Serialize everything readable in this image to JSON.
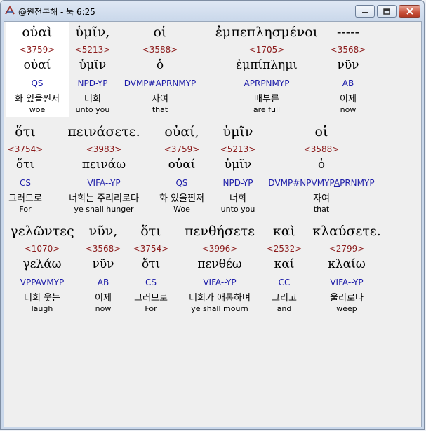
{
  "window": {
    "title": "@원전본해 - 눅 6:25",
    "buttons": {
      "minimize": "minimize-icon",
      "maximize": "maximize-icon",
      "close": "close-icon"
    }
  },
  "rows": [
    {
      "words": [
        {
          "greek": "οὐαὶ",
          "strong": "<3759>",
          "lemma": "οὐαί",
          "morph": "QS",
          "korean": "화 있을찐저",
          "english": "woe"
        },
        {
          "greek": "ὑμῖν,",
          "strong": "<5213>",
          "lemma": "ὑμῖν",
          "morph": "NPD-YP",
          "korean": "너희",
          "english": "unto you"
        },
        {
          "greek": "οἱ",
          "strong": "<3588>",
          "lemma": "ὁ",
          "morph": "DVMP#APRNMYP",
          "korean": "자여",
          "english": "that"
        },
        {
          "greek": "ἐμπεπλησμένοι",
          "strong": "<1705>",
          "lemma": "ἐμπίπλημι",
          "morph": "APRPNMYP",
          "korean": "배부른",
          "english": "are full"
        },
        {
          "greek": "-----",
          "strong": "<3568>",
          "lemma": "νῦν",
          "morph": "AB",
          "korean": "이제",
          "english": "now"
        }
      ]
    },
    {
      "words": [
        {
          "greek": "ὅτι",
          "strong": "<3754>",
          "lemma": "ὅτι",
          "morph": "CS",
          "korean": "그러므로",
          "english": "For"
        },
        {
          "greek": "πεινάσετε.",
          "strong": "<3983>",
          "lemma": "πεινάω",
          "morph": "VIFA--YP",
          "korean": "너희는 주리리로다",
          "english": "ye shall hunger"
        },
        {
          "greek": "οὐαί,",
          "strong": "<3759>",
          "lemma": "οὐαί",
          "morph": "QS",
          "korean": "화 있을찐저",
          "english": "Woe"
        },
        {
          "greek": "ὑμῖν",
          "strong": "<5213>",
          "lemma": "ὑμῖν",
          "morph": "NPD-YP",
          "korean": "너희",
          "english": "unto you"
        },
        {
          "greek": "οἱ",
          "strong": "<3588>",
          "lemma": "ὁ",
          "morph_a": "DVMP#NPVMYP",
          "morph_b": "A",
          "morph_c": "PRNMYP",
          "korean": "자여",
          "english": "that"
        }
      ]
    },
    {
      "words": [
        {
          "greek": "γελῶντες",
          "strong": "<1070>",
          "lemma": "γελάω",
          "morph": "VPPAVMYP",
          "korean": "너희 웃는",
          "english": "laugh"
        },
        {
          "greek": "νῦν,",
          "strong": "<3568>",
          "lemma": "νῦν",
          "morph": "AB",
          "korean": "이제",
          "english": "now"
        },
        {
          "greek": "ὅτι",
          "strong": "<3754>",
          "lemma": "ὅτι",
          "morph": "CS",
          "korean": "그러므로",
          "english": "For"
        },
        {
          "greek": "πενθήσετε",
          "strong": "<3996>",
          "lemma": "πενθέω",
          "morph": "VIFA--YP",
          "korean": "너희가 애통하며",
          "english": "ye shall mourn"
        },
        {
          "greek": "καὶ",
          "strong": "<2532>",
          "lemma": "καί",
          "morph": "CC",
          "korean": "그리고",
          "english": "and"
        },
        {
          "greek": "κλαύσετε.",
          "strong": "<2799>",
          "lemma": "κλαίω",
          "morph": "VIFA--YP",
          "korean": "울리로다",
          "english": "weep"
        }
      ]
    }
  ]
}
